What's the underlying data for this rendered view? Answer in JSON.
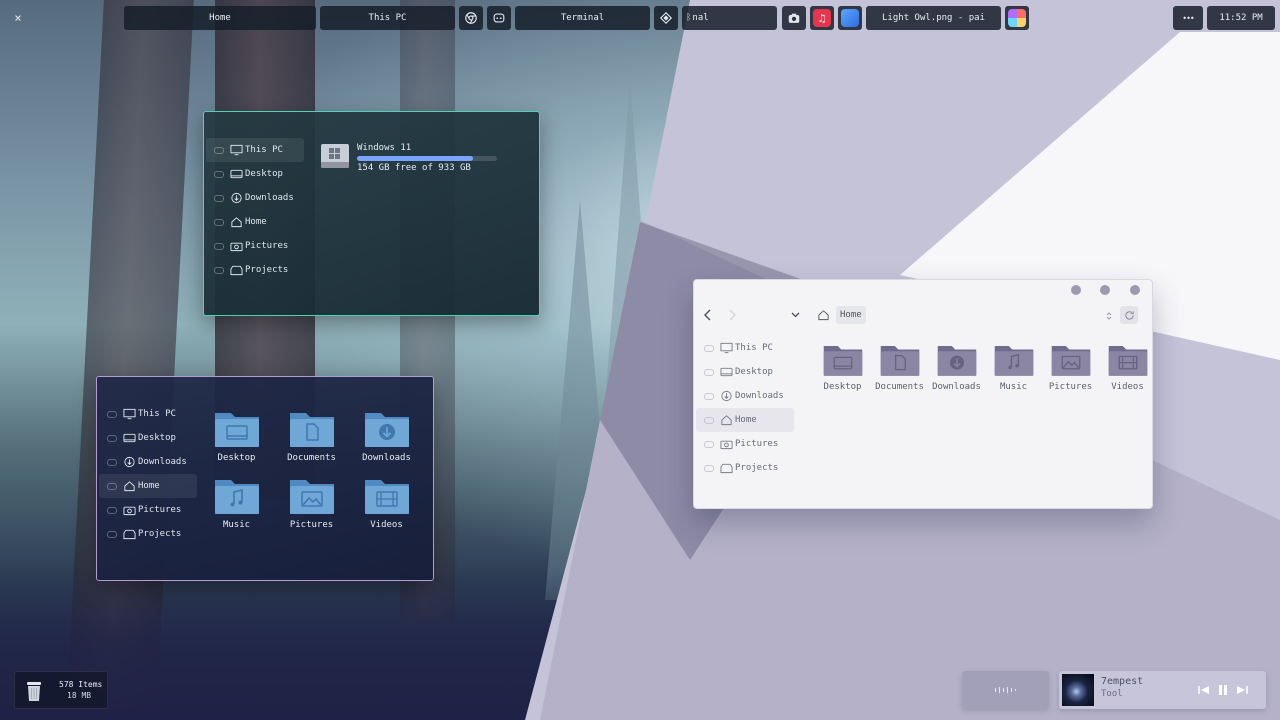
{
  "topbar": {
    "close_glyph": "×",
    "tabs": [
      {
        "label": "Home"
      },
      {
        "label": "This PC"
      },
      {
        "label": "Terminal"
      },
      {
        "label": "nal"
      },
      {
        "label": "Light Owl.png - pai"
      }
    ],
    "more_glyph": "•••",
    "clock": "11:52 PM"
  },
  "this_pc_window": {
    "sidebar": [
      {
        "label": "This PC",
        "icon": "monitor-icon",
        "active": true
      },
      {
        "label": "Desktop",
        "icon": "desktop-icon"
      },
      {
        "label": "Downloads",
        "icon": "download-icon"
      },
      {
        "label": "Home",
        "icon": "home-icon"
      },
      {
        "label": "Pictures",
        "icon": "camera-icon"
      },
      {
        "label": "Projects",
        "icon": "projects-icon"
      }
    ],
    "drive": {
      "name": "Windows 11",
      "usage": "154 GB free of 933 GB",
      "used_fraction": 0.83
    }
  },
  "home_window_dark": {
    "sidebar": [
      {
        "label": "This PC"
      },
      {
        "label": "Desktop"
      },
      {
        "label": "Downloads"
      },
      {
        "label": "Home",
        "active": true
      },
      {
        "label": "Pictures"
      },
      {
        "label": "Projects"
      }
    ],
    "folders": [
      {
        "label": "Desktop",
        "icon": "desktop-folder-icon"
      },
      {
        "label": "Documents",
        "icon": "documents-folder-icon"
      },
      {
        "label": "Downloads",
        "icon": "downloads-folder-icon"
      },
      {
        "label": "Music",
        "icon": "music-folder-icon"
      },
      {
        "label": "Pictures",
        "icon": "pictures-folder-icon"
      },
      {
        "label": "Videos",
        "icon": "videos-folder-icon"
      }
    ]
  },
  "home_window_light": {
    "breadcrumb": "Home",
    "sidebar": [
      {
        "label": "This PC"
      },
      {
        "label": "Desktop"
      },
      {
        "label": "Downloads"
      },
      {
        "label": "Home",
        "active": true
      },
      {
        "label": "Pictures"
      },
      {
        "label": "Projects"
      }
    ],
    "folders": [
      {
        "label": "Desktop"
      },
      {
        "label": "Documents"
      },
      {
        "label": "Downloads"
      },
      {
        "label": "Music"
      },
      {
        "label": "Pictures"
      },
      {
        "label": "Videos"
      }
    ]
  },
  "trash": {
    "items": "578 Items",
    "size": "18 MB"
  },
  "player": {
    "title": "7empest",
    "artist": "Tool"
  },
  "colors": {
    "accent_teal": "#4fd3b5",
    "accent_lavender": "#b59bd6",
    "folder_blue": "#6fa7d6",
    "folder_grey": "#8a86a3"
  }
}
